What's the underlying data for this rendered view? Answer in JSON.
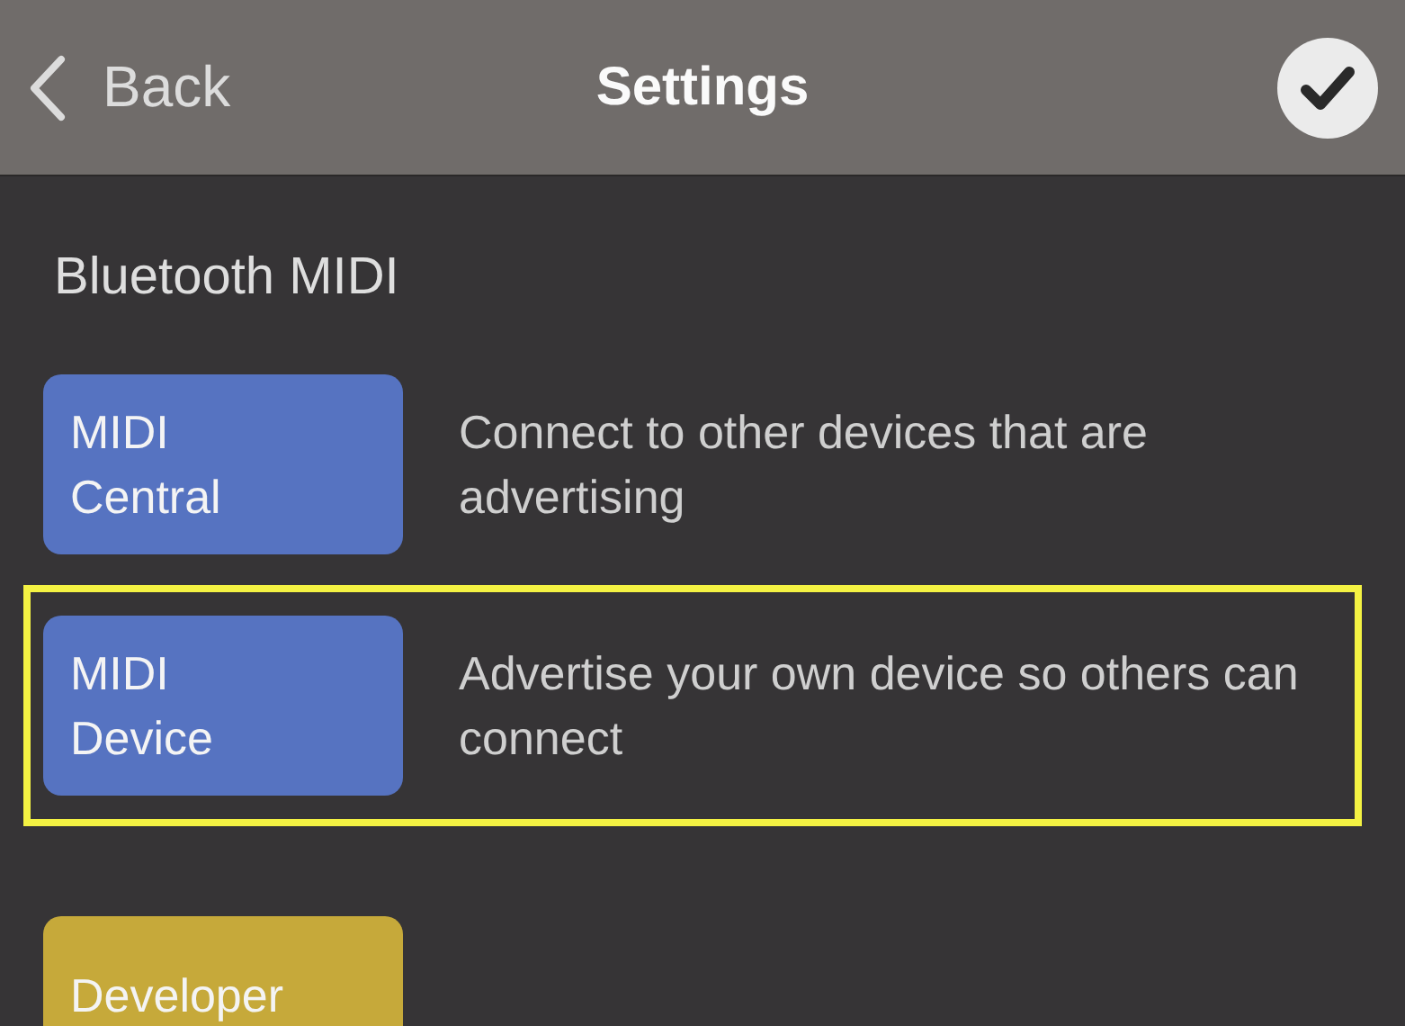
{
  "header": {
    "back_label": "Back",
    "title": "Settings"
  },
  "section": {
    "heading": "Bluetooth MIDI"
  },
  "rows": [
    {
      "label": "MIDI Central",
      "description": "Connect to other devices that are advertising",
      "color": "#5673c1",
      "highlighted": false
    },
    {
      "label": "MIDI Device",
      "description": "Advertise your own device so others can connect",
      "color": "#5673c1",
      "highlighted": true
    },
    {
      "label": "Developer",
      "color": "#c6a93a",
      "highlighted": false
    }
  ]
}
